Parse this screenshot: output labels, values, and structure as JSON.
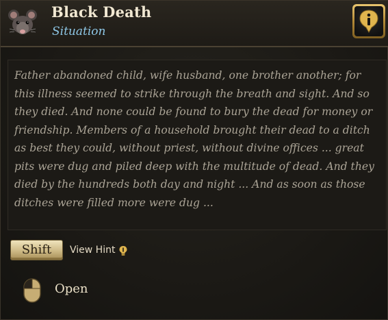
{
  "header": {
    "title": "Black Death",
    "subtitle": "Situation",
    "portrait_icon": "rat-icon",
    "info_icon": "info-icon"
  },
  "description": {
    "text": "Father abandoned child, wife husband, one brother another; for this illness seemed to strike through the breath and sight. And so they died. And none could be found to bury the dead for money or friendship. Members of a household brought their dead to a ditch as best they could, without priest, without divine offices ... great pits were dug and piled deep with the multitude of dead. And they died by the hundreds both day and night ... And as soon as those ditches were filled more were dug ..."
  },
  "hints": {
    "shift_key": "Shift",
    "view_hint_label": "View Hint",
    "hint_icon": "lightbulb-icon",
    "mouse_icon": "mouse-left-click-icon",
    "open_label": "Open"
  },
  "colors": {
    "title": "#f1e8d2",
    "subtitle": "#8ec7e6",
    "flavor_text": "#aba496",
    "gold_accent": "#d2ae5a"
  }
}
